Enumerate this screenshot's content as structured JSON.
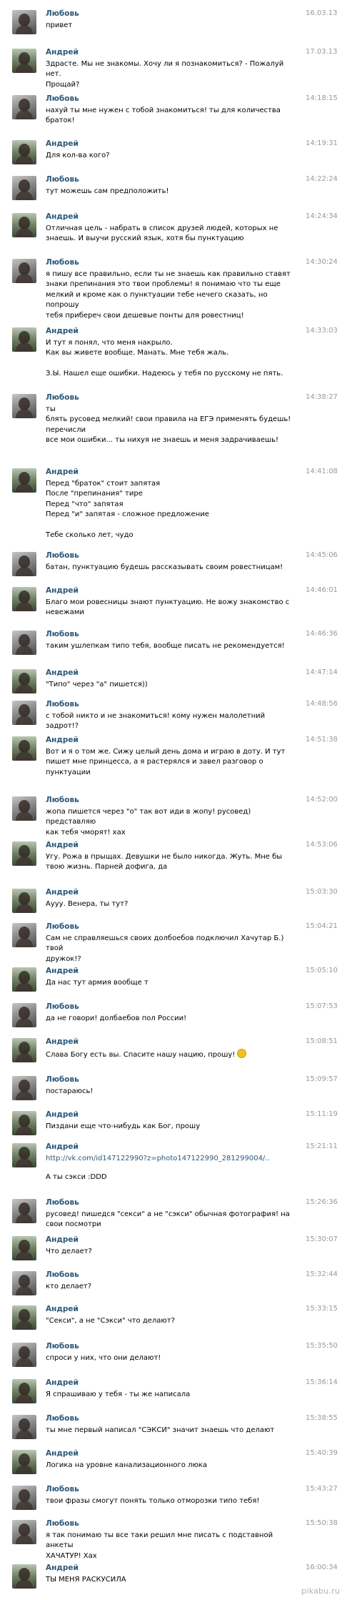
{
  "names": {
    "lub": "Любовь",
    "and": "Андрей"
  },
  "messages": [
    {
      "who": "lub",
      "time": "16.03.13",
      "text": "привет"
    },
    {
      "who": "and",
      "time": "17.03.13",
      "text": "Здрасте. Мы не знакомы. Хочу ли я познакомиться? - Пожалуй нет.\nПрощай?"
    },
    {
      "who": "lub",
      "time": "14:18:15",
      "text": "нахуй ты мне нужен с тобой знакомиться! ты для количества\nбраток!"
    },
    {
      "who": "and",
      "time": "14:19:31",
      "text": "Для кол-ва кого?"
    },
    {
      "who": "lub",
      "time": "14:22:24",
      "text": "тут можешь сам предположить!"
    },
    {
      "who": "and",
      "time": "14:24:34",
      "text": "Отличная цель - набрать в список друзей людей, которых не\nзнаешь. И выучи русский язык, хотя бы пунктуацию"
    },
    {
      "who": "lub",
      "time": "14:30:24",
      "text": "я пишу все правильно, если ты не знаешь как правильно ставят\nзнаки препинания это твои проблемы! я понимаю что ты еще\nмелкий и кроме как о пунктуации тебе нечего сказать, но попрошу\nтебя прибереч свои дешевые понты для ровестниц!"
    },
    {
      "who": "and",
      "time": "14:33:03",
      "text": "И тут я понял, что меня накрыло.\nКак вы живете вообще. Манать. Мне тебя жаль.\n\nЗ.Ы. Нашел еще ошибки. Надеюсь у тебя по русскому не пять."
    },
    {
      "who": "lub",
      "time": "14:38:27",
      "text": "ты\nблять русовед мелкий! свои правила на ЕГЭ применять будешь!\nперечисли\nвсе мои ошибки... ты нихуя не знаешь и меня задрачиваешь!"
    },
    {
      "who": "and",
      "time": "14:41:08",
      "text": "Перед \"браток\" стоит запятая\nПосле \"препинания\" тире\nПеред \"что\" запятая\nПеред \"и\" запятая - сложное предложение\n\nТебе сколько лет, чудо"
    },
    {
      "who": "lub",
      "time": "14:45:06",
      "text": "батан, пунктуацию будешь рассказывать своим ровестницам!"
    },
    {
      "who": "and",
      "time": "14:46:01",
      "text": "Благо мои ровесницы знают пунктуацию. Не вожу знакомство с\nневежами"
    },
    {
      "who": "lub",
      "time": "14:46:36",
      "text": "таким ушлепкам типо тебя, вообще писать не рекомендуется!"
    },
    {
      "who": "and",
      "time": "14:47:14",
      "text": "\"Типо\" через \"а\" пишется))"
    },
    {
      "who": "lub",
      "time": "14:48:56",
      "text": "с тобой никто и не знакомиться! кому нужен малолетний задрот!?"
    },
    {
      "who": "and",
      "time": "14:51:38",
      "text": "Вот и я о том же. Сижу целый день дома и играю в доту. И тут\nпишет мне принцесса, а я растерялся и завел разговор о\nпунктуации"
    },
    {
      "who": "lub",
      "time": "14:52:00",
      "text": "жопа пишется через \"о\" так вот иди в жопу! русовед) представляю\nкак тебя чморят! хах"
    },
    {
      "who": "and",
      "time": "14:53:06",
      "text": "Угу. Рожа в прыщах. Девушки не было никогда. Жуть. Мне бы\nтвою жизнь. Парней дофига, да"
    },
    {
      "who": "and",
      "time": "15:03:30",
      "text": "Аууу. Венера, ты тут?"
    },
    {
      "who": "lub",
      "time": "15:04:21",
      "text": "Сам не справляешься своих долбоебов подключил Хачутар Б.) твой\nдружок!?"
    },
    {
      "who": "and",
      "time": "15:05:10",
      "text": "Да нас тут армия вообще т"
    },
    {
      "who": "lub",
      "time": "15:07:53",
      "text": "да не говори! долбаебов пол России!"
    },
    {
      "who": "and",
      "time": "15:08:51",
      "text": "Слава Богу есть вы. Спасите нашу нацию, прошу!"
    },
    {
      "who": "lub",
      "time": "15:09:57",
      "text": "постараюсь!"
    },
    {
      "who": "and",
      "time": "15:11:19",
      "text": "Пиздани еще что-нибудь как Бог, прошу"
    },
    {
      "who": "and",
      "time": "15:21:11",
      "text": "А ты сэкси :DDD",
      "link": "http://vk.com/id147122990?z=photo147122990_281299004/.."
    },
    {
      "who": "lub",
      "time": "15:26:36",
      "text": "русовед! пишедся \"секси\" а не \"сэкси\" обычная фотография! на\nсвои посмотри"
    },
    {
      "who": "and",
      "time": "15:30:07",
      "text": "Что делает?"
    },
    {
      "who": "lub",
      "time": "15:32:44",
      "text": "кто делает?"
    },
    {
      "who": "and",
      "time": "15:33:15",
      "text": "\"Секси\", а не \"Сэкси\" что делают?"
    },
    {
      "who": "lub",
      "time": "15:35:50",
      "text": "спроси у них, что они делают!"
    },
    {
      "who": "and",
      "time": "15:36:14",
      "text": "Я спрашиваю у тебя - ты же написала"
    },
    {
      "who": "lub",
      "time": "15:38:55",
      "text": "ты мне первый написал \"СЭКСИ\" значит знаешь что делают"
    },
    {
      "who": "and",
      "time": "15:40:39",
      "text": "Логика на уровне канализационного люка"
    },
    {
      "who": "lub",
      "time": "15:43:27",
      "text": "твои фразы смогут понять только отморозки типо тебя!"
    },
    {
      "who": "lub",
      "time": "15:50:38",
      "text": "я так понимаю ты все таки решил мне писать с подставной анкеты\nХАЧАТУР! Хах"
    },
    {
      "who": "and",
      "time": "16:00:34",
      "text": "ТЫ МЕНЯ РАСКУСИЛА"
    }
  ],
  "watermark": "pikabu.ru"
}
